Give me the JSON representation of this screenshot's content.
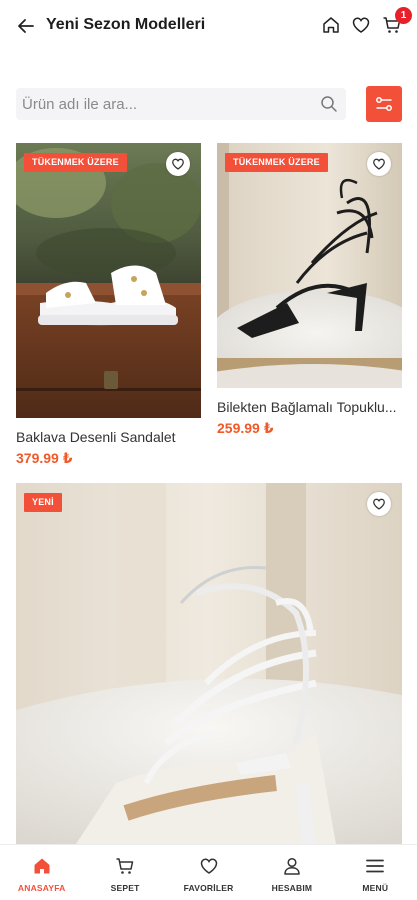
{
  "header": {
    "title": "Yeni Sezon Modelleri",
    "cart_count": "1"
  },
  "search": {
    "placeholder": "Ürün adı ile ara..."
  },
  "products": [
    {
      "badge": "TÜKENMEK ÜZERE",
      "name": "Baklava Desenli Sandalet",
      "price": "379.99 ₺"
    },
    {
      "badge": "TÜKENMEK ÜZERE",
      "name": "Bilekten Bağlamalı Topuklu...",
      "price": "259.99 ₺"
    },
    {
      "badge": "YENİ"
    }
  ],
  "bottom_nav": [
    {
      "label": "ANASAYFA",
      "icon": "home-icon",
      "active": true
    },
    {
      "label": "SEPET",
      "icon": "cart-icon"
    },
    {
      "label": "FAVORİLER",
      "icon": "heart-icon"
    },
    {
      "label": "HESABIM",
      "icon": "user-icon"
    },
    {
      "label": "MENÜ",
      "icon": "menu-icon"
    }
  ],
  "colors": {
    "accent": "#f3503a",
    "price": "#f05a28",
    "badge_cart": "#e8202a"
  }
}
